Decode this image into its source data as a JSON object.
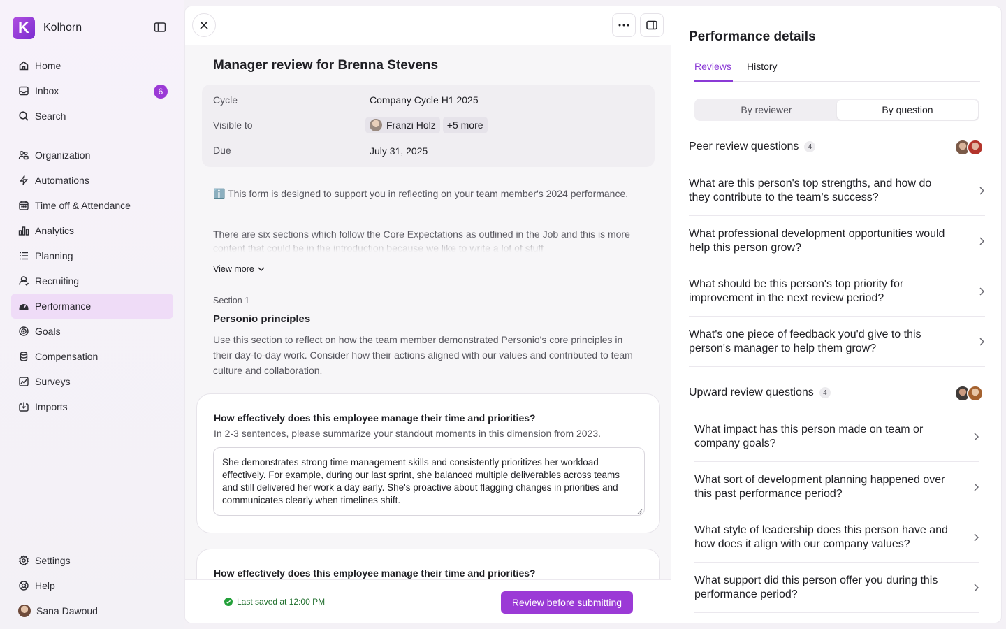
{
  "app": {
    "name": "Kolhorn",
    "logo_letter": "K",
    "accent": "#9b3ad6"
  },
  "nav": {
    "top": [
      {
        "label": "Home",
        "icon": "home-icon"
      },
      {
        "label": "Inbox",
        "icon": "inbox-icon",
        "badge": "6"
      },
      {
        "label": "Search",
        "icon": "search-icon"
      }
    ],
    "modules": [
      {
        "label": "Organization",
        "icon": "organization-icon"
      },
      {
        "label": "Automations",
        "icon": "lightning-icon"
      },
      {
        "label": "Time off & Attendance",
        "icon": "calendar-icon"
      },
      {
        "label": "Analytics",
        "icon": "bar-chart-icon"
      },
      {
        "label": "Planning",
        "icon": "list-icon"
      },
      {
        "label": "Recruiting",
        "icon": "recruiting-icon"
      },
      {
        "label": "Performance",
        "icon": "gauge-icon",
        "active": true
      },
      {
        "label": "Goals",
        "icon": "target-icon"
      },
      {
        "label": "Compensation",
        "icon": "coins-icon"
      },
      {
        "label": "Surveys",
        "icon": "survey-icon"
      },
      {
        "label": "Imports",
        "icon": "import-icon"
      }
    ],
    "bottom": [
      {
        "label": "Settings",
        "icon": "gear-icon"
      },
      {
        "label": "Help",
        "icon": "help-icon"
      }
    ],
    "user": {
      "name": "Sana Dawoud"
    }
  },
  "review": {
    "title": "Manager review for Brenna Stevens",
    "meta": {
      "cycle_label": "Cycle",
      "cycle_value": "Company Cycle H1 2025",
      "visible_label": "Visible to",
      "visible_person": "Franzi Holz",
      "visible_more": "+5 more",
      "due_label": "Due",
      "due_value": "July 31, 2025"
    },
    "intro_icon": "ℹ️",
    "intro": "This form is designed to support you in reflecting on your team member's 2024 performance.",
    "intro_more": "There are six sections which follow the Core Expectations as outlined in the Job  and this is more content that could be in the introduction because we like to write a lot of stuff",
    "view_more": "View more",
    "section_label": "Section 1",
    "section_title": "Personio principles",
    "section_desc": "Use this section to reflect on how the team member demonstrated Personio's core principles in their day-to-day work. Consider how their actions aligned with our values and contributed to team culture and collaboration.",
    "questions": [
      {
        "title": "How effectively does this employee manage their time and priorities?",
        "subtitle": "In 2-3 sentences, please summarize your standout moments in this dimension from 2023.",
        "answer": "She demonstrates strong time management skills and consistently prioritizes her workload effectively. For example, during our last sprint, she balanced multiple deliverables across teams and still delivered her work a day early. She's proactive about flagging changes in priorities and communicates clearly when timelines shift."
      },
      {
        "title": "How effectively does this employee manage their time and priorities?"
      }
    ],
    "saved_text": "Last saved at 12:00 PM",
    "submit_label": "Review before submitting"
  },
  "panel": {
    "title": "Performance details",
    "tabs": [
      "Reviews",
      "History"
    ],
    "active_tab": "Reviews",
    "segments": [
      "By reviewer",
      "By question"
    ],
    "active_segment": "By question",
    "groups": [
      {
        "title": "Peer review questions",
        "count": "4",
        "questions": [
          "What are this person's top strengths, and how do they contribute to the team's success?",
          "What professional development opportunities would help this person grow?",
          "What should be this person's top priority for improvement in the next review period?",
          "What's one piece of feedback you'd give to this person's manager to help them grow?"
        ]
      },
      {
        "title": "Upward review questions",
        "count": "4",
        "questions": [
          "What impact has this person made on team or company goals?",
          "What sort of development planning happened over this past performance period?",
          "What style of leadership does this person have and how does it align with our company values?",
          "What support did this person offer you during this performance period?"
        ]
      }
    ]
  }
}
